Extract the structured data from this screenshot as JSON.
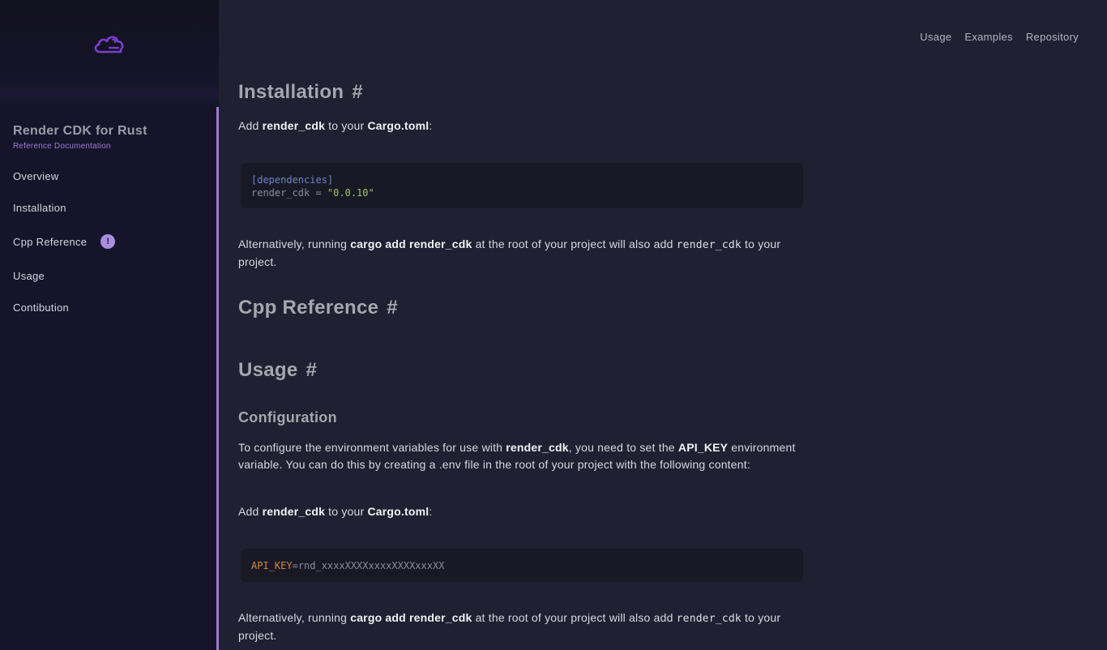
{
  "sidebar": {
    "brand_title": "Render CDK for Rust",
    "brand_subtitle": "Reference Documentation",
    "logo_icon": "cloud-icon",
    "items": [
      {
        "label": "Overview"
      },
      {
        "label": "Installation"
      },
      {
        "label": "Cpp Reference",
        "badge": "!"
      },
      {
        "label": "Usage"
      },
      {
        "label": "Contibution"
      }
    ]
  },
  "topnav": {
    "links": [
      "Usage",
      "Examples",
      "Repository"
    ]
  },
  "content": {
    "installation": {
      "heading": "Installation",
      "hash": "#",
      "add_text_1": "Add ",
      "add_bold_1": "render_cdk",
      "add_text_2": " to your ",
      "add_bold_2": "Cargo.toml",
      "add_text_3": ":",
      "code_section": "[dependencies]",
      "code_key": "render_cdk = ",
      "code_value": "\"0.0.10\"",
      "alt_text_1": "Alternatively, running ",
      "alt_bold": "cargo add render_cdk",
      "alt_text_2": " at the root of your project will also add ",
      "alt_code": "render_cdk",
      "alt_text_3": " to your project."
    },
    "cpp_reference": {
      "heading": "Cpp Reference",
      "hash": "#"
    },
    "usage": {
      "heading": "Usage",
      "hash": "#",
      "subheading": "Configuration",
      "config_text_1": "To configure the environment variables for use with ",
      "config_bold_1": "render_cdk",
      "config_text_2": ", you need to set the ",
      "config_bold_2": "API_KEY",
      "config_text_3": " environment variable. You can do this by creating a .env file in the root of your project with the following content:",
      "add_text_1": "Add ",
      "add_bold_1": "render_cdk",
      "add_text_2": " to your ",
      "add_bold_2": "Cargo.toml",
      "add_text_3": ":",
      "env_key": "API_KEY",
      "env_eq": "=",
      "env_value": "rnd_xxxxXXXXxxxxXXXXxxxXX",
      "alt_text_1": "Alternatively, running ",
      "alt_bold": "cargo add render_cdk",
      "alt_text_2": " at the root of your project will also add ",
      "alt_code": "render_cdk",
      "alt_text_3": " to your project."
    }
  },
  "colors": {
    "accent": "#9f7ad6",
    "background": "#1f2031",
    "sidebar": "#15142a"
  }
}
